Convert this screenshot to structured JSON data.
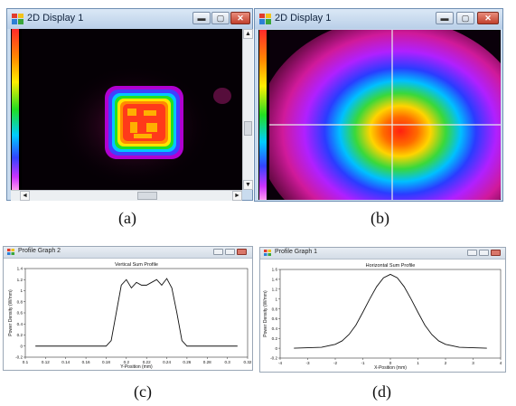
{
  "display_a": {
    "title": "2D Display 1",
    "caption": "(a)",
    "buttons": {
      "minimize": "▬",
      "maximize": "▢",
      "close": "✕"
    },
    "scroll_arrows": {
      "up": "▲",
      "down": "▼",
      "left": "◄",
      "right": "►"
    }
  },
  "display_b": {
    "title": "2D Display 1",
    "caption": "(b)",
    "buttons": {
      "minimize": "▬",
      "maximize": "▢",
      "close": "✕"
    }
  },
  "profile_c": {
    "window_title": "Profile Graph 2",
    "caption": "(c)",
    "chart_data": {
      "type": "line",
      "title": "Vertical Sum Profile",
      "xlabel": "Y-Position (mm)",
      "ylabel": "Power Density (W/mm)",
      "xlim": [
        0.1,
        0.32
      ],
      "ylim": [
        -0.2,
        1.4
      ],
      "xticks": [
        "0.1",
        "0.12",
        "0.14",
        "0.16",
        "0.18",
        "0.2",
        "0.22",
        "0.24",
        "0.26",
        "0.28",
        "0.3",
        "0.32"
      ],
      "yticks": [
        "1.4",
        "1.2",
        "1",
        "0.8",
        "0.6",
        "0.4",
        "0.2",
        "0",
        "-0.2"
      ],
      "series": [
        {
          "x": [
            0.11,
            0.18,
            0.185,
            0.19,
            0.195,
            0.2,
            0.205,
            0.21,
            0.215,
            0.22,
            0.225,
            0.23,
            0.235,
            0.24,
            0.245,
            0.25,
            0.255,
            0.26,
            0.31
          ],
          "y": [
            0,
            0,
            0.1,
            0.6,
            1.1,
            1.2,
            1.05,
            1.15,
            1.1,
            1.1,
            1.15,
            1.2,
            1.1,
            1.22,
            1.05,
            0.6,
            0.1,
            0,
            0
          ]
        }
      ]
    }
  },
  "profile_d": {
    "window_title": "Profile Graph 1",
    "caption": "(d)",
    "chart_data": {
      "type": "line",
      "title": "Horizontal Sum Profile",
      "xlabel": "X-Position (mm)",
      "ylabel": "Power Density (W/mm)",
      "xlim": [
        -4,
        4
      ],
      "ylim": [
        -0.2,
        1.6
      ],
      "xticks": [
        "-4",
        "-3",
        "-2",
        "-1",
        "0",
        "1",
        "2",
        "3",
        "4"
      ],
      "yticks": [
        "1.6",
        "1.4",
        "1.2",
        "1",
        "0.8",
        "0.6",
        "0.4",
        "0.2",
        "0",
        "-0.2"
      ],
      "series": [
        {
          "x": [
            -3.5,
            -3,
            -2.5,
            -2,
            -1.75,
            -1.5,
            -1.25,
            -1,
            -0.75,
            -0.5,
            -0.25,
            0,
            0.25,
            0.5,
            0.75,
            1,
            1.25,
            1.5,
            1.75,
            2,
            2.5,
            3,
            3.5
          ],
          "y": [
            0,
            0.01,
            0.02,
            0.08,
            0.15,
            0.28,
            0.47,
            0.73,
            1.0,
            1.25,
            1.43,
            1.5,
            1.43,
            1.25,
            1.0,
            0.73,
            0.47,
            0.28,
            0.15,
            0.08,
            0.02,
            0.01,
            0
          ]
        }
      ]
    }
  }
}
